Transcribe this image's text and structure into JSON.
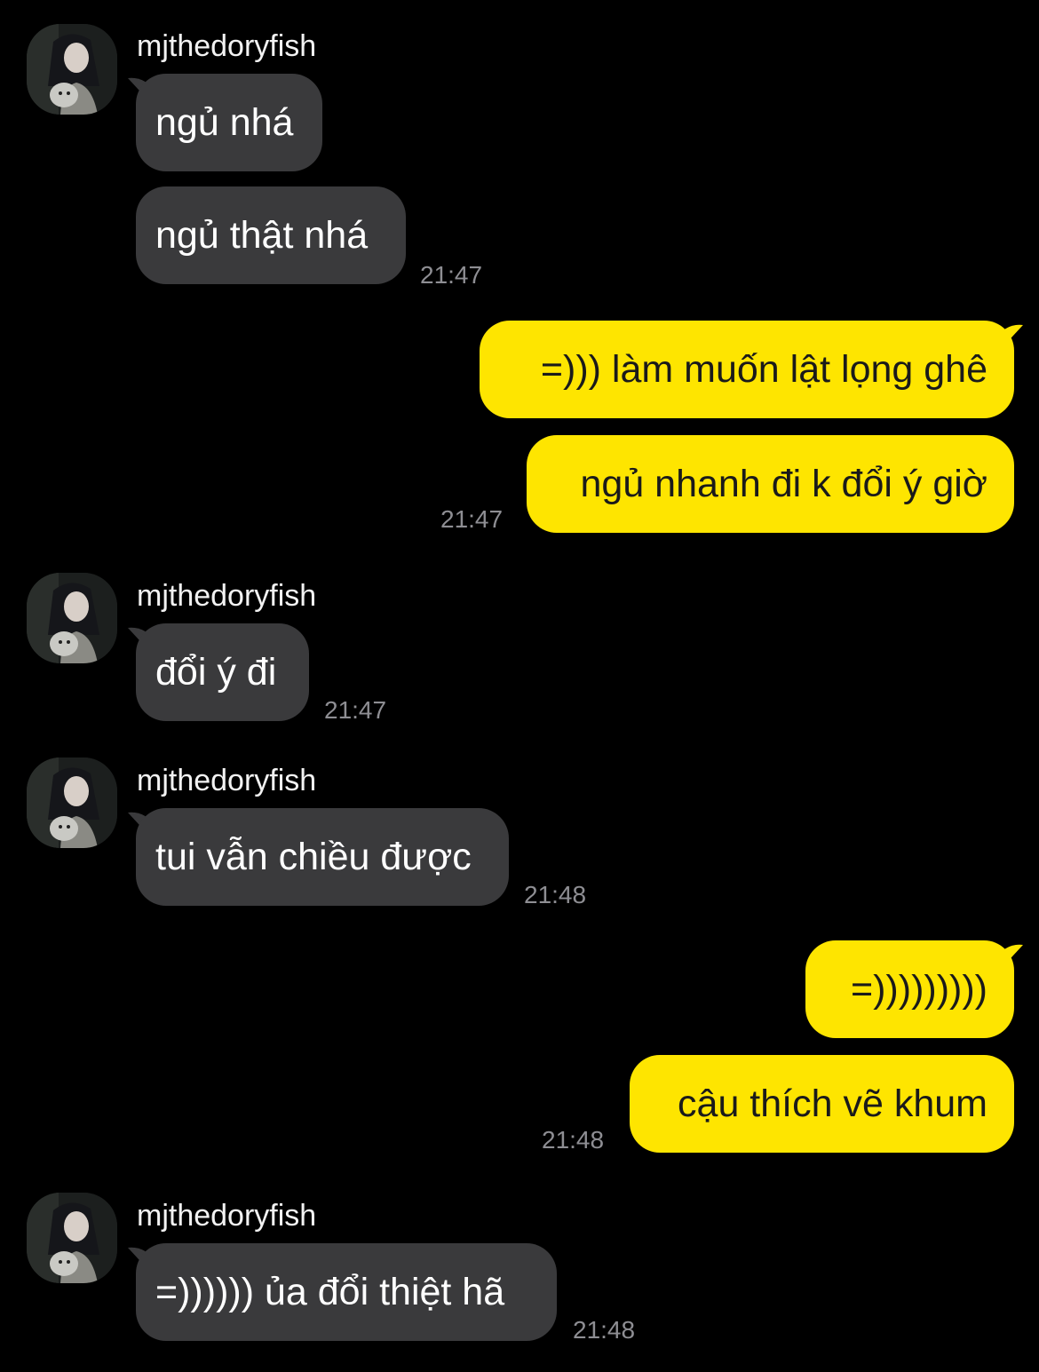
{
  "colors": {
    "background": "#000000",
    "incoming_bubble": "#3a3a3c",
    "outgoing_bubble": "#fee500",
    "timestamp": "#8e8e93"
  },
  "groups": [
    {
      "sender": "mjthedoryfish",
      "avatar_icon": "profile-photo-avatar",
      "messages": [
        "ngủ nhá",
        "ngủ thật nhá"
      ],
      "time": "21:47"
    },
    {
      "sender": "me",
      "messages": [
        "=))) làm muốn lật lọng ghê",
        "ngủ nhanh đi k đổi ý giờ"
      ],
      "time": "21:47"
    },
    {
      "sender": "mjthedoryfish",
      "avatar_icon": "profile-photo-avatar",
      "messages": [
        "đổi ý đi"
      ],
      "time": "21:47"
    },
    {
      "sender": "mjthedoryfish",
      "avatar_icon": "profile-photo-avatar",
      "messages": [
        "tui vẫn chiều được"
      ],
      "time": "21:48"
    },
    {
      "sender": "me",
      "messages": [
        "=)))))))))",
        "cậu thích vẽ khum"
      ],
      "time": "21:48"
    },
    {
      "sender": "mjthedoryfish",
      "avatar_icon": "profile-photo-avatar",
      "messages": [
        "=)))))) ủa đổi thiệt hã"
      ],
      "time": "21:48"
    }
  ]
}
